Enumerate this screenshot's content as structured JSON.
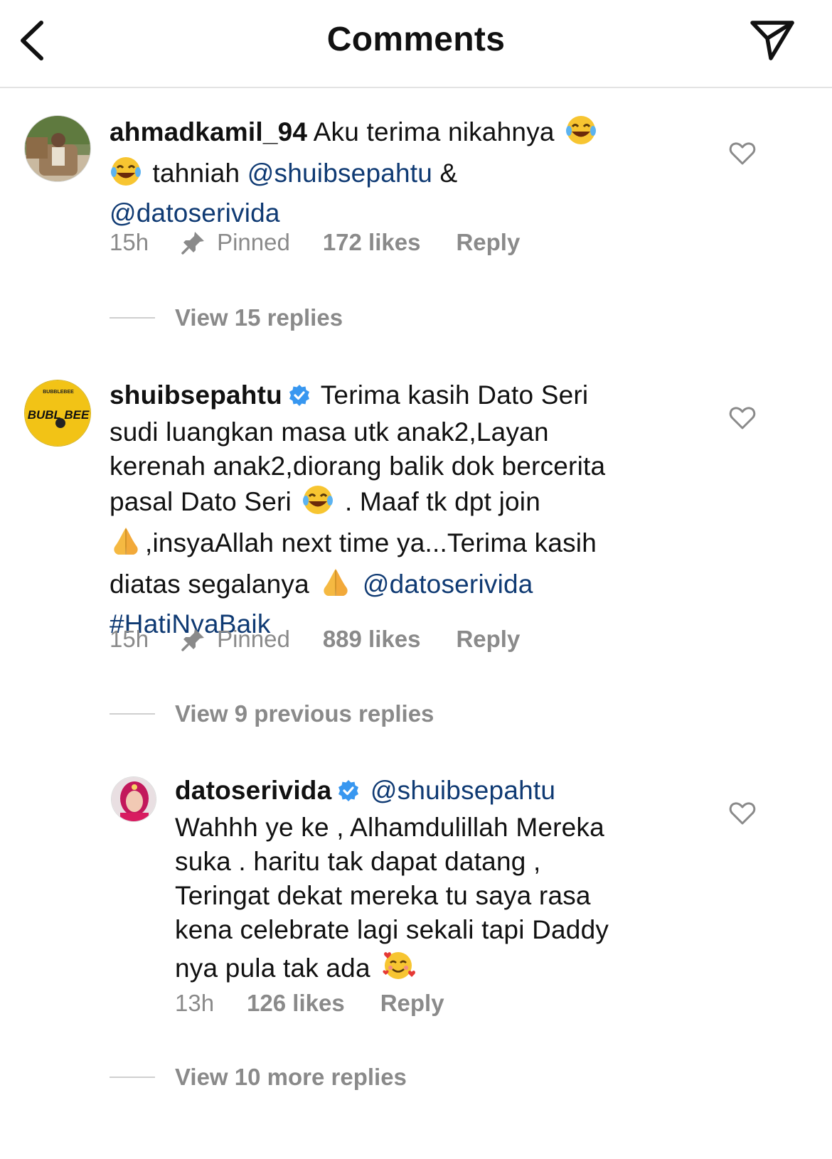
{
  "header": {
    "title": "Comments",
    "back_icon": "chevron-left-icon",
    "send_icon": "paper-plane-icon"
  },
  "colors": {
    "mention": "#0f3a73",
    "meta": "#8a8a8a",
    "verified": "#3897f0",
    "divider": "#e3e3e3"
  },
  "comments": [
    {
      "username": "ahmadkamil_94",
      "text_1": "Aku terima nikahnya",
      "emoji_1": "face-with-tears-of-joy",
      "emoji_2": "face-with-tears-of-joy",
      "text_2": "tahniah",
      "mention_1": "@shuibsepahtu",
      "text_3": "&",
      "mention_2": "@datoserivida",
      "time": "15h",
      "pinned": "Pinned",
      "likes": "172 likes",
      "reply": "Reply",
      "view_replies": "View 15 replies"
    },
    {
      "username": "shuibsepahtu",
      "avatar_text_top": "BUBBLEBEE",
      "avatar_text_main": "BUBL BEE",
      "text_1": "Terima kasih Dato Seri",
      "text_2": "sudi luangkan masa utk anak2,Layan",
      "text_3": "kerenah anak2,diorang balik dok bercerita",
      "text_4": "pasal Dato Seri",
      "text_5": ". Maaf tk dpt join",
      "text_6": ",insyaAllah next time ya...Terima kasih",
      "text_7": "diatas segalanya",
      "mention_1": "@datoserivida",
      "hashtag": "#HatiNyaBaik",
      "time": "15h",
      "pinned": "Pinned",
      "likes": "889 likes",
      "reply": "Reply",
      "view_replies": "View 9 previous replies"
    },
    {
      "username": "datoserivida",
      "mention_1": "@shuibsepahtu",
      "text_1": "Wahhh ye ke , Alhamdulillah Mereka",
      "text_2": "suka . haritu tak dapat datang ,",
      "text_3": "Teringat dekat mereka tu saya rasa",
      "text_4": "kena celebrate lagi sekali tapi Daddy",
      "text_5": "nya pula tak ada",
      "time": "13h",
      "likes": "126 likes",
      "reply": "Reply",
      "view_replies": "View 10 more replies"
    }
  ]
}
